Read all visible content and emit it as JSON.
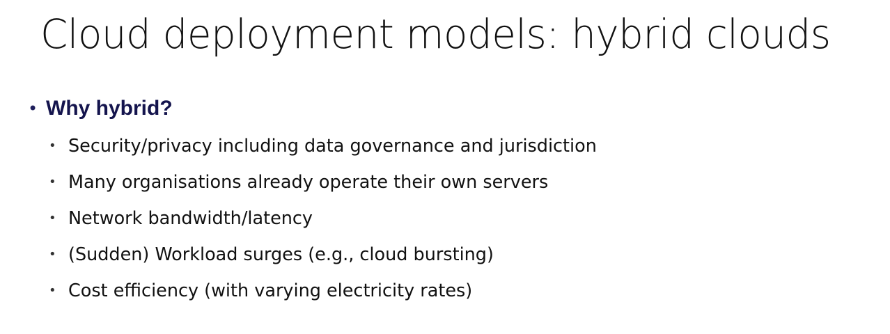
{
  "slide": {
    "title": "Cloud deployment models: hybrid clouds",
    "bullet_glyph": "•",
    "main_point": "Why hybrid?",
    "sub_points": [
      "Security/privacy including data governance and jurisdiction",
      "Many organisations already operate their own servers",
      "Network bandwidth/latency",
      "(Sudden) Workload surges (e.g., cloud bursting)",
      "Cost efficiency (with varying electricity rates)"
    ]
  },
  "colors": {
    "main_point": "#14144d",
    "body_text": "#111111",
    "background": "#ffffff"
  }
}
